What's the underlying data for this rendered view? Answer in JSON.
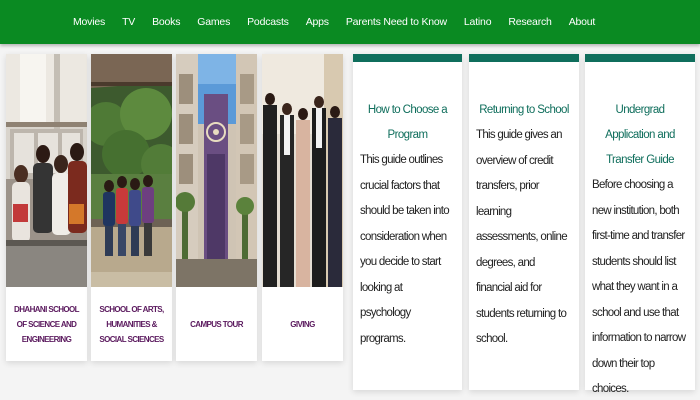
{
  "nav": {
    "items": [
      "Movies",
      "TV",
      "Books",
      "Games",
      "Podcasts",
      "Apps",
      "Parents Need to Know",
      "Latino",
      "Research",
      "About"
    ]
  },
  "tiles": [
    {
      "caption": "DHAHANI SCHOOL OF SCIENCE AND ENGINEERING",
      "image": "students-in-lab-photo"
    },
    {
      "caption": "SCHOOL OF ARTS, HUMANITIES & SOCIAL SCIENCES",
      "image": "students-outdoor-photo"
    },
    {
      "caption": "CAMPUS TOUR",
      "image": "campus-building-photo"
    },
    {
      "caption": "GIVING",
      "image": "group-formal-photo"
    }
  ],
  "guides": [
    {
      "title": "How to Choose a Program",
      "body": "This guide outlines crucial factors that should be taken into consideration when you decide to start looking at psychology programs."
    },
    {
      "title": "Returning to School",
      "body": "This guide gives an overview of credit transfers, prior learning assessments, online degrees, and financial aid for students returning to school."
    },
    {
      "title": "Undergrad Application and Transfer Guide",
      "body": "Before choosing a new institution, both first-time and transfer students should list what they want in a school and use that information to narrow down their top choices."
    }
  ],
  "colors": {
    "nav_bg": "#0a8a22",
    "caption_text": "#5b1a5e",
    "guide_accent": "#0f6e5c"
  }
}
